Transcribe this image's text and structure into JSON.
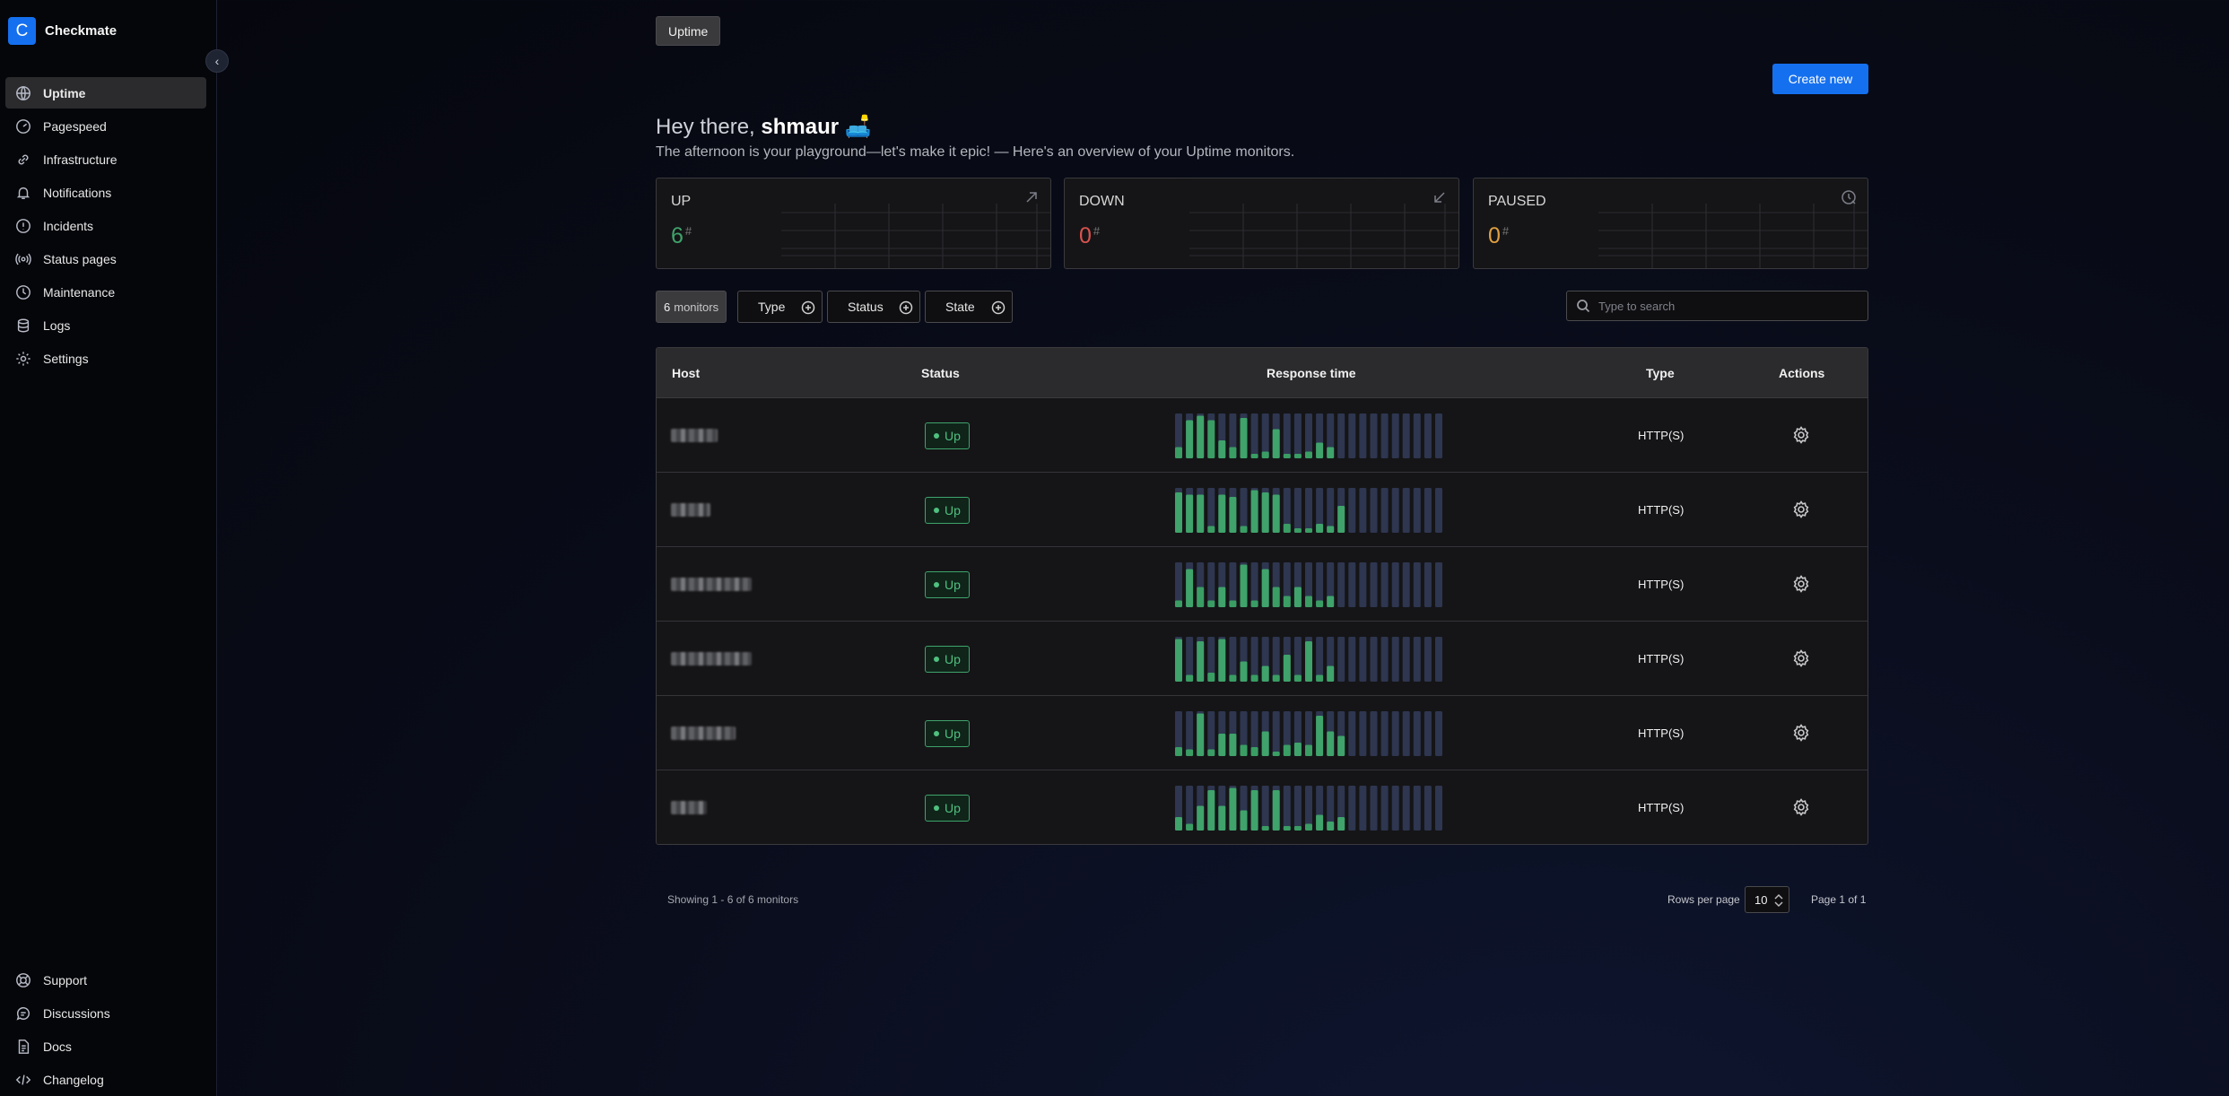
{
  "brand": {
    "logo_letter": "C",
    "name": "Checkmate"
  },
  "sidebar": {
    "items": [
      {
        "label": "Uptime",
        "icon": "globe-icon",
        "active": true
      },
      {
        "label": "Pagespeed",
        "icon": "gauge-icon"
      },
      {
        "label": "Infrastructure",
        "icon": "link-icon"
      },
      {
        "label": "Notifications",
        "icon": "bell-icon"
      },
      {
        "label": "Incidents",
        "icon": "alert-circle-icon"
      },
      {
        "label": "Status pages",
        "icon": "broadcast-icon"
      },
      {
        "label": "Maintenance",
        "icon": "clock-icon"
      },
      {
        "label": "Logs",
        "icon": "database-icon"
      },
      {
        "label": "Settings",
        "icon": "gear-icon"
      }
    ],
    "bottom_items": [
      {
        "label": "Support",
        "icon": "lifebuoy-icon"
      },
      {
        "label": "Discussions",
        "icon": "chat-icon"
      },
      {
        "label": "Docs",
        "icon": "document-icon"
      },
      {
        "label": "Changelog",
        "icon": "code-icon"
      }
    ]
  },
  "breadcrumb": "Uptime",
  "create_button": "Create new",
  "greeting": {
    "prefix": "Hey there, ",
    "user": "shmaur",
    "emoji": "🛋️"
  },
  "subtitle": "The afternoon is your playground—let's make it epic! — Here's an overview of your Uptime monitors.",
  "stats": [
    {
      "label": "UP",
      "value": "6",
      "suffix": "#",
      "color": "#3fa36b",
      "icon": "arrow-up-right-icon"
    },
    {
      "label": "DOWN",
      "value": "0",
      "suffix": "#",
      "color": "#d9534f",
      "icon": "arrow-down-left-icon"
    },
    {
      "label": "PAUSED",
      "value": "0",
      "suffix": "#",
      "color": "#e0a040",
      "icon": "clock-pause-icon"
    }
  ],
  "filters": {
    "count_number": "6",
    "count_label": "monitors",
    "type": "Type",
    "status": "Status",
    "state": "State",
    "search_placeholder": "Type to search"
  },
  "table": {
    "headers": {
      "host": "Host",
      "status": "Status",
      "response": "Response time",
      "type": "Type",
      "actions": "Actions"
    },
    "rows": [
      {
        "status": "Up",
        "type": "HTTP(S)",
        "host_width": 52,
        "bars": [
          [
            0,
            0.25
          ],
          [
            1,
            0.85
          ],
          [
            1,
            0.95
          ],
          [
            0,
            0.85
          ],
          [
            1,
            0.4
          ],
          [
            0,
            0.25
          ],
          [
            1,
            0.9
          ],
          [
            0,
            0.1
          ],
          [
            0,
            0.15
          ],
          [
            1,
            0.65
          ],
          [
            0,
            0.1
          ],
          [
            0,
            0.1
          ],
          [
            0,
            0.15
          ],
          [
            1,
            0.35
          ],
          [
            1,
            0.25
          ],
          [
            0,
            0
          ],
          [
            0,
            0
          ],
          [
            0,
            0
          ],
          [
            0,
            0
          ],
          [
            0,
            0
          ],
          [
            0,
            0
          ],
          [
            0,
            0
          ],
          [
            0,
            0
          ],
          [
            0,
            0
          ],
          [
            0,
            0
          ]
        ]
      },
      {
        "status": "Up",
        "type": "HTTP(S)",
        "host_width": 44,
        "bars": [
          [
            1,
            0.9
          ],
          [
            1,
            0.85
          ],
          [
            1,
            0.85
          ],
          [
            0,
            0.15
          ],
          [
            1,
            0.85
          ],
          [
            1,
            0.8
          ],
          [
            0,
            0.15
          ],
          [
            1,
            0.95
          ],
          [
            1,
            0.9
          ],
          [
            1,
            0.85
          ],
          [
            0,
            0.2
          ],
          [
            0,
            0.1
          ],
          [
            0,
            0.1
          ],
          [
            1,
            0.2
          ],
          [
            1,
            0.15
          ],
          [
            1,
            0.6
          ],
          [
            0,
            0
          ],
          [
            0,
            0
          ],
          [
            0,
            0
          ],
          [
            0,
            0
          ],
          [
            0,
            0
          ],
          [
            0,
            0
          ],
          [
            0,
            0
          ],
          [
            0,
            0
          ],
          [
            0,
            0
          ]
        ]
      },
      {
        "status": "Up",
        "type": "HTTP(S)",
        "host_width": 90,
        "bars": [
          [
            0,
            0.15
          ],
          [
            1,
            0.85
          ],
          [
            0,
            0.45
          ],
          [
            0,
            0.15
          ],
          [
            1,
            0.45
          ],
          [
            0,
            0.15
          ],
          [
            1,
            0.95
          ],
          [
            0,
            0.15
          ],
          [
            1,
            0.85
          ],
          [
            0,
            0.45
          ],
          [
            0,
            0.25
          ],
          [
            1,
            0.45
          ],
          [
            0,
            0.25
          ],
          [
            0,
            0.15
          ],
          [
            1,
            0.25
          ],
          [
            0,
            0
          ],
          [
            0,
            0
          ],
          [
            0,
            0
          ],
          [
            0,
            0
          ],
          [
            0,
            0
          ],
          [
            0,
            0
          ],
          [
            0,
            0
          ],
          [
            0,
            0
          ],
          [
            0,
            0
          ],
          [
            0,
            0
          ]
        ]
      },
      {
        "status": "Up",
        "type": "HTTP(S)",
        "host_width": 90,
        "bars": [
          [
            1,
            0.95
          ],
          [
            0,
            0.15
          ],
          [
            1,
            0.9
          ],
          [
            0,
            0.2
          ],
          [
            1,
            0.95
          ],
          [
            0,
            0.15
          ],
          [
            1,
            0.45
          ],
          [
            0,
            0.15
          ],
          [
            1,
            0.35
          ],
          [
            0,
            0.15
          ],
          [
            1,
            0.6
          ],
          [
            0,
            0.15
          ],
          [
            1,
            0.9
          ],
          [
            0,
            0.15
          ],
          [
            1,
            0.35
          ],
          [
            0,
            0
          ],
          [
            0,
            0
          ],
          [
            0,
            0
          ],
          [
            0,
            0
          ],
          [
            0,
            0
          ],
          [
            0,
            0
          ],
          [
            0,
            0
          ],
          [
            0,
            0
          ],
          [
            0,
            0
          ],
          [
            0,
            0
          ]
        ]
      },
      {
        "status": "Up",
        "type": "HTTP(S)",
        "host_width": 72,
        "bars": [
          [
            0,
            0.2
          ],
          [
            0,
            0.15
          ],
          [
            1,
            0.95
          ],
          [
            0,
            0.15
          ],
          [
            1,
            0.5
          ],
          [
            1,
            0.5
          ],
          [
            0,
            0.25
          ],
          [
            0,
            0.2
          ],
          [
            1,
            0.55
          ],
          [
            0,
            0.1
          ],
          [
            0,
            0.25
          ],
          [
            1,
            0.3
          ],
          [
            0,
            0.25
          ],
          [
            1,
            0.9
          ],
          [
            1,
            0.55
          ],
          [
            1,
            0.45
          ],
          [
            0,
            0
          ],
          [
            0,
            0
          ],
          [
            0,
            0
          ],
          [
            0,
            0
          ],
          [
            0,
            0
          ],
          [
            0,
            0
          ],
          [
            0,
            0
          ],
          [
            0,
            0
          ],
          [
            0,
            0
          ]
        ]
      },
      {
        "status": "Up",
        "type": "HTTP(S)",
        "host_width": 40,
        "bars": [
          [
            1,
            0.3
          ],
          [
            0,
            0.15
          ],
          [
            1,
            0.55
          ],
          [
            1,
            0.9
          ],
          [
            1,
            0.55
          ],
          [
            1,
            0.95
          ],
          [
            1,
            0.45
          ],
          [
            1,
            0.9
          ],
          [
            0,
            0.1
          ],
          [
            1,
            0.9
          ],
          [
            0,
            0.1
          ],
          [
            0,
            0.1
          ],
          [
            0,
            0.15
          ],
          [
            1,
            0.35
          ],
          [
            1,
            0.2
          ],
          [
            1,
            0.3
          ],
          [
            0,
            0
          ],
          [
            0,
            0
          ],
          [
            0,
            0
          ],
          [
            0,
            0
          ],
          [
            0,
            0
          ],
          [
            0,
            0
          ],
          [
            0,
            0
          ],
          [
            0,
            0
          ],
          [
            0,
            0
          ]
        ]
      }
    ]
  },
  "footer": {
    "showing": "Showing 1 - 6 of 6 monitors",
    "rows_per_page_label": "Rows per page",
    "rows_per_page_value": "10",
    "page_info": "Page 1 of 1"
  },
  "colors": {
    "accent": "#1570ef",
    "bar_up": "#3fa36b",
    "bar_empty": "#2e3650"
  }
}
